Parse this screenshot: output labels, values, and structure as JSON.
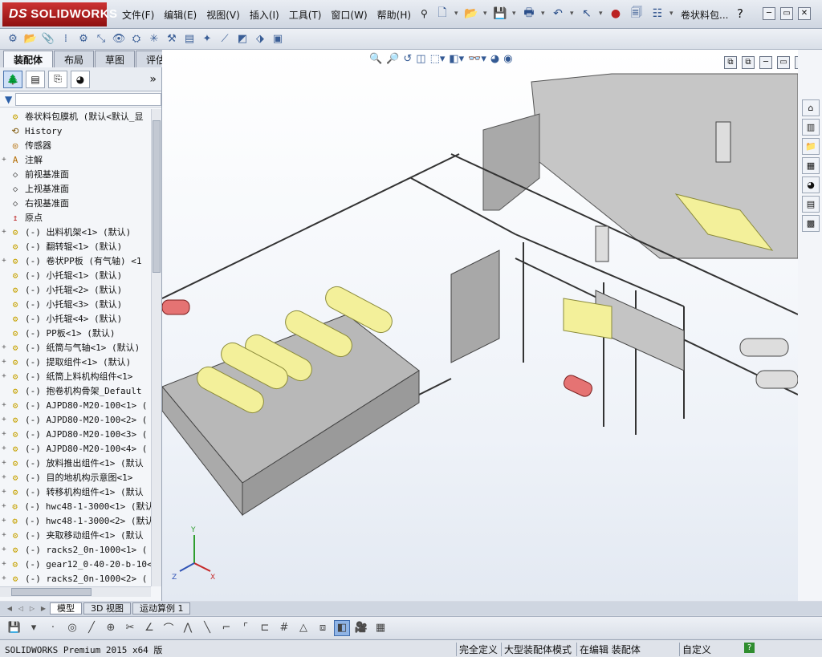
{
  "app": {
    "logo_prefix": "DS",
    "logo_text": "SOLIDWORKS",
    "doc_title": "卷状料包...",
    "help_label": "?",
    "window_controls": [
      "─",
      "▭",
      "✕"
    ]
  },
  "menu": [
    "文件(F)",
    "编辑(E)",
    "视图(V)",
    "插入(I)",
    "工具(T)",
    "窗口(W)",
    "帮助(H)"
  ],
  "command_tabs": [
    "装配体",
    "布局",
    "草图",
    "评估"
  ],
  "feature_tree": {
    "root": "卷状料包膜机  (默认<默认_显",
    "items": [
      {
        "label": "History",
        "icon": "history-icon",
        "expander": ""
      },
      {
        "label": "传感器",
        "icon": "sensor-icon",
        "expander": ""
      },
      {
        "label": "注解",
        "icon": "annotation-icon",
        "expander": "+"
      },
      {
        "label": "前视基准面",
        "icon": "plane-icon",
        "expander": ""
      },
      {
        "label": "上视基准面",
        "icon": "plane-icon",
        "expander": ""
      },
      {
        "label": "右视基准面",
        "icon": "plane-icon",
        "expander": ""
      },
      {
        "label": "原点",
        "icon": "origin-icon",
        "expander": ""
      },
      {
        "label": "(-) 出料机架<1> (默认)",
        "icon": "part-icon",
        "expander": "+"
      },
      {
        "label": "(-) 翻转辊<1> (默认)",
        "icon": "part-icon",
        "expander": ""
      },
      {
        "label": "(-) 卷状PP板 (有气轴) <1",
        "icon": "assembly-icon",
        "expander": "+"
      },
      {
        "label": "(-) 小托辊<1> (默认)",
        "icon": "part-icon",
        "expander": ""
      },
      {
        "label": "(-) 小托辊<2> (默认)",
        "icon": "part-icon",
        "expander": ""
      },
      {
        "label": "(-) 小托辊<3> (默认)",
        "icon": "part-icon",
        "expander": ""
      },
      {
        "label": "(-) 小托辊<4> (默认)",
        "icon": "part-icon",
        "expander": ""
      },
      {
        "label": "(-) PP板<1> (默认)",
        "icon": "part-icon",
        "expander": ""
      },
      {
        "label": "(-) 纸筒与气轴<1> (默认)",
        "icon": "assembly-icon",
        "expander": "+"
      },
      {
        "label": "(-) 提取组件<1> (默认)",
        "icon": "assembly-icon",
        "expander": "+"
      },
      {
        "label": "(-) 纸筒上料机构组件<1>",
        "icon": "assembly-icon",
        "expander": "+"
      },
      {
        "label": "(-) 抱卷机构骨架_Default",
        "icon": "part-icon",
        "expander": ""
      },
      {
        "label": "(-) AJPD80-M20-100<1> (",
        "icon": "assembly-icon",
        "expander": "+"
      },
      {
        "label": "(-) AJPD80-M20-100<2> (",
        "icon": "assembly-icon",
        "expander": "+"
      },
      {
        "label": "(-) AJPD80-M20-100<3> (",
        "icon": "assembly-icon",
        "expander": "+"
      },
      {
        "label": "(-) AJPD80-M20-100<4> (",
        "icon": "assembly-icon",
        "expander": "+"
      },
      {
        "label": "(-) 放料推出组件<1> (默认",
        "icon": "assembly-icon",
        "expander": "+"
      },
      {
        "label": "(-) 目的地机构示意图<1>",
        "icon": "assembly-icon",
        "expander": "+"
      },
      {
        "label": "(-) 转移机构组件<1> (默认",
        "icon": "assembly-icon",
        "expander": "+"
      },
      {
        "label": "(-) hwc48-1-3000<1> (默认",
        "icon": "assembly-icon",
        "expander": "+"
      },
      {
        "label": "(-) hwc48-1-3000<2> (默认",
        "icon": "assembly-icon",
        "expander": "+"
      },
      {
        "label": "(-) 夹取移动组件<1> (默认",
        "icon": "assembly-icon",
        "expander": "+"
      },
      {
        "label": "(-) racks2_0n-1000<1> (",
        "icon": "assembly-icon",
        "expander": "+"
      },
      {
        "label": "(-) gear12_0-40-20-b-10<",
        "icon": "assembly-icon",
        "expander": "+"
      },
      {
        "label": "(-) racks2_0n-1000<2> (",
        "icon": "assembly-icon",
        "expander": "+"
      }
    ]
  },
  "bottom_tabs": [
    "模型",
    "3D 视图",
    "运动算例 1"
  ],
  "status": {
    "version": "SOLIDWORKS Premium 2015 x64 版",
    "fields": [
      "完全定义",
      "大型装配体模式",
      "在编辑 装配体",
      "自定义"
    ]
  },
  "colors": {
    "accent": "#c62828",
    "frame_metal": "#9ea3aa",
    "roll_yellow": "#f3f09a",
    "background_top": "#ffffff"
  }
}
